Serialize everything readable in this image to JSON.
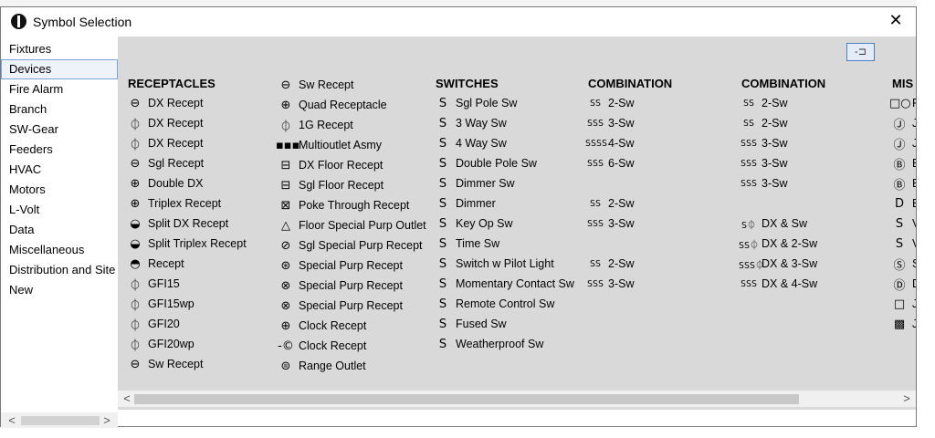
{
  "window": {
    "title": "Symbol Selection",
    "close_glyph": "✕"
  },
  "categories": [
    "Fixtures",
    "Devices",
    "Fire Alarm",
    "Branch",
    "SW-Gear",
    "Feeders",
    "HVAC",
    "Motors",
    "L-Volt",
    "Data",
    "Miscellaneous",
    "Distribution and Site",
    "New"
  ],
  "selected_category": "Devices",
  "pin_glyph": "-⊐",
  "columns": [
    {
      "title": "RECEPTACLES",
      "items": [
        {
          "sym": "⊖",
          "label": "DX Recept"
        },
        {
          "sym": "⏀",
          "label": "DX Recept"
        },
        {
          "sym": "⏀",
          "label": "DX Recept"
        },
        {
          "sym": "⊖",
          "label": "Sgl Recept"
        },
        {
          "sym": "⊕",
          "label": "Double DX"
        },
        {
          "sym": "⊕",
          "label": "Triplex Recept"
        },
        {
          "sym": "◒",
          "label": "Split DX Recept"
        },
        {
          "sym": "◒",
          "label": "Split Triplex Recept"
        },
        {
          "sym": "◓",
          "label": "Recept"
        },
        {
          "sym": "⏀",
          "label": "GFI15"
        },
        {
          "sym": "⏀",
          "label": "GFI15wp"
        },
        {
          "sym": "⏀",
          "label": "GFI20"
        },
        {
          "sym": "⏀",
          "label": "GFI20wp"
        },
        {
          "sym": "⊖",
          "label": "Sw Recept"
        }
      ]
    },
    {
      "title": "",
      "items": [
        {
          "sym": "⊖",
          "label": "Sw Recept"
        },
        {
          "sym": "⊕",
          "label": "Quad Receptacle"
        },
        {
          "sym": "⏀",
          "label": "1G Recept"
        },
        {
          "sym": "▪▪▪",
          "label": "Multioutlet Asmy"
        },
        {
          "sym": "⊟",
          "label": "DX Floor Recept"
        },
        {
          "sym": "⊟",
          "label": "Sgl Floor Recept"
        },
        {
          "sym": "⊠",
          "label": "Poke Through Recept"
        },
        {
          "sym": "△",
          "label": "Floor Special Purp Outlet"
        },
        {
          "sym": "⊘",
          "label": "Sgl Special Purp Recept"
        },
        {
          "sym": "⊛",
          "label": "Special Purp Recept"
        },
        {
          "sym": "⊗",
          "label": "Special Purp Recept"
        },
        {
          "sym": "⊗",
          "label": "Special Purp Recept"
        },
        {
          "sym": "⊕",
          "label": "Clock Recept"
        },
        {
          "sym": "-©",
          "label": "Clock Recept"
        },
        {
          "sym": "⊜",
          "label": "Range Outlet"
        }
      ]
    },
    {
      "title": "SWITCHES",
      "items": [
        {
          "sym": "S",
          "label": "Sgl Pole Sw"
        },
        {
          "sym": "S",
          "label": "3 Way Sw"
        },
        {
          "sym": "S",
          "label": "4 Way Sw"
        },
        {
          "sym": "S",
          "label": "Double Pole Sw"
        },
        {
          "sym": "S",
          "label": "Dimmer Sw"
        },
        {
          "sym": "S",
          "label": "Dimmer"
        },
        {
          "sym": "S",
          "label": "Key Op Sw"
        },
        {
          "sym": "S",
          "label": "Time Sw"
        },
        {
          "sym": "S",
          "label": "Switch w Pilot Light"
        },
        {
          "sym": "S",
          "label": "Momentary Contact Sw"
        },
        {
          "sym": "S",
          "label": "Remote Control Sw"
        },
        {
          "sym": "S",
          "label": "Fused Sw"
        },
        {
          "sym": "S",
          "label": "Weatherproof Sw"
        }
      ]
    },
    {
      "title": "COMBINATION",
      "items": [
        {
          "sym": "SS",
          "label": "2-Sw"
        },
        {
          "sym": "SSS",
          "label": "3-Sw"
        },
        {
          "sym": "SSSS",
          "label": "4-Sw"
        },
        {
          "sym": "SSS",
          "label": "6-Sw"
        },
        {
          "sym": "",
          "label": ""
        },
        {
          "sym": "SS",
          "label": "2-Sw"
        },
        {
          "sym": "SSS",
          "label": "3-Sw"
        },
        {
          "sym": "",
          "label": ""
        },
        {
          "sym": "SS",
          "label": "2-Sw"
        },
        {
          "sym": "SSS",
          "label": "3-Sw"
        }
      ]
    },
    {
      "title": "COMBINATION",
      "items": [
        {
          "sym": "SS",
          "label": "2-Sw"
        },
        {
          "sym": "SS",
          "label": "2-Sw"
        },
        {
          "sym": "SSS",
          "label": "3-Sw"
        },
        {
          "sym": "SSS",
          "label": "3-Sw"
        },
        {
          "sym": "SSS",
          "label": "3-Sw"
        },
        {
          "sym": "",
          "label": ""
        },
        {
          "sym": "S⏀",
          "label": "DX & Sw"
        },
        {
          "sym": "SS⏀",
          "label": "DX & 2-Sw"
        },
        {
          "sym": "SSS⏀",
          "label": "DX & 3-Sw"
        },
        {
          "sym": "SSS",
          "label": "DX & 4-Sw"
        }
      ]
    },
    {
      "title": "MIS",
      "items": [
        {
          "sym": "□○",
          "label": "F"
        },
        {
          "sym": "Ⓙ",
          "label": "J"
        },
        {
          "sym": "Ⓙ",
          "label": "J"
        },
        {
          "sym": "Ⓑ",
          "label": "E"
        },
        {
          "sym": "Ⓑ",
          "label": "E"
        },
        {
          "sym": "D",
          "label": "E"
        },
        {
          "sym": "S",
          "label": "V"
        },
        {
          "sym": "S",
          "label": "V"
        },
        {
          "sym": "Ⓢ",
          "label": "S"
        },
        {
          "sym": "Ⓓ",
          "label": "D"
        },
        {
          "sym": "□",
          "label": "J"
        },
        {
          "sym": "▩",
          "label": "J"
        }
      ]
    }
  ],
  "scroll": {
    "left_arrow": "<",
    "right_arrow": ">"
  }
}
